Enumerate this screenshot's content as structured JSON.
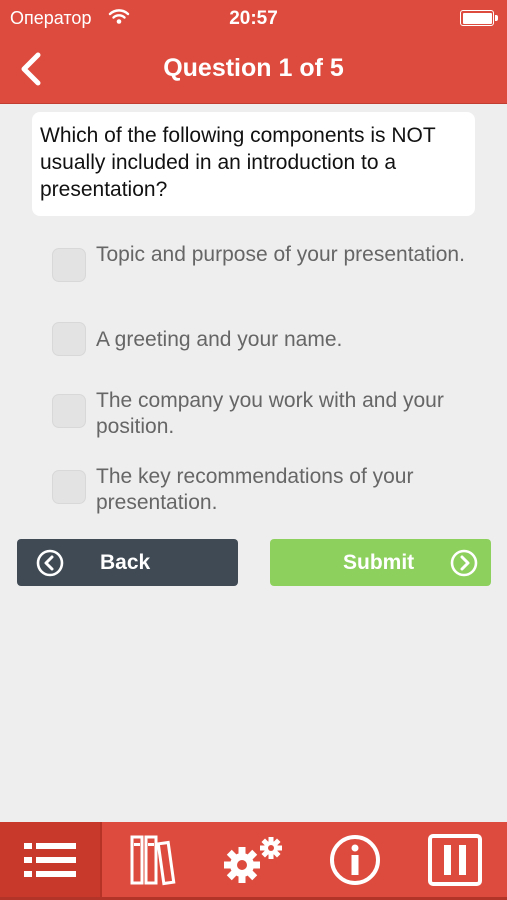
{
  "status_bar": {
    "carrier": "Оператор",
    "time": "20:57"
  },
  "nav": {
    "title": "Question 1 of 5",
    "back_icon": "chevron-left-icon"
  },
  "question": {
    "text": "Which of the following components is NOT usually included in an introduction to a presentation?"
  },
  "options": [
    {
      "label": "Topic and purpose of your presentation.",
      "checked": false
    },
    {
      "label": "A greeting and your name.",
      "checked": false
    },
    {
      "label": "The company you work with and your position.",
      "checked": false
    },
    {
      "label": "The key recommendations of your presentation.",
      "checked": false
    }
  ],
  "buttons": {
    "back_label": "Back",
    "submit_label": "Submit"
  },
  "tabbar": {
    "tabs": [
      {
        "icon": "list-icon",
        "active": true
      },
      {
        "icon": "books-icon",
        "active": false
      },
      {
        "icon": "gears-icon",
        "active": false
      },
      {
        "icon": "info-icon",
        "active": false
      },
      {
        "icon": "pause-icon",
        "active": false
      }
    ]
  },
  "colors": {
    "header": "#dd4b3e",
    "back_button": "#3f4a54",
    "submit_button": "#8ed05d",
    "background": "#eeeeee"
  }
}
